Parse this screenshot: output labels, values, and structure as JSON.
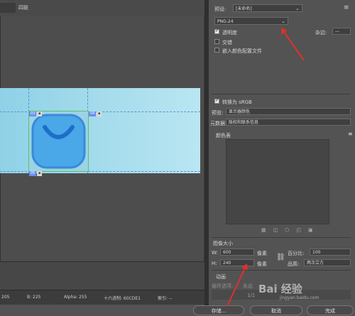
{
  "tabs": [
    "四联"
  ],
  "slices": [
    {
      "id": "03",
      "icon": "slice-icon"
    },
    {
      "id": "04",
      "icon": "slice-icon"
    },
    {
      "id": "05",
      "icon": "slice-icon"
    }
  ],
  "status": {
    "g": "205",
    "b": "B: 225",
    "alpha": "Alpha: 255",
    "hex": "十六进制: 60CDE1",
    "index": "索引: --"
  },
  "right": {
    "preset_label": "预设:",
    "preset_value": "[未命名]",
    "format_value": "PNG-24",
    "transparency": "透明度",
    "matte_label": "杂边:",
    "interlaced": "交错",
    "embed_profile": "嵌入颜色配置文件",
    "convert_srgb": "转换为 sRGB",
    "preview_label": "预览:",
    "preview_value": "显示器颜色",
    "metadata_label": "元数据:",
    "metadata_value": "版权和联系信息",
    "color_table": "颜色表",
    "image_size": "图像大小",
    "w_label": "W:",
    "w_value": "600",
    "h_label": "H:",
    "h_value": "240",
    "unit": "像素",
    "percent_label": "百分比:",
    "percent_value": "100",
    "quality_label": "品质:",
    "quality_value": "两次立方",
    "animation": "动画",
    "loop_label": "循环选项:",
    "loop_value": "永远",
    "frame_counter": "1/1",
    "btn_save": "存储...",
    "btn_cancel": "取消",
    "btn_done": "完成"
  },
  "watermark": {
    "text": "Bai 经验",
    "url": "jingyan.baidu.com"
  },
  "colors": {
    "image": "#60CDE1",
    "icon": "#3a8ad8",
    "arrow": "#e0302a"
  }
}
